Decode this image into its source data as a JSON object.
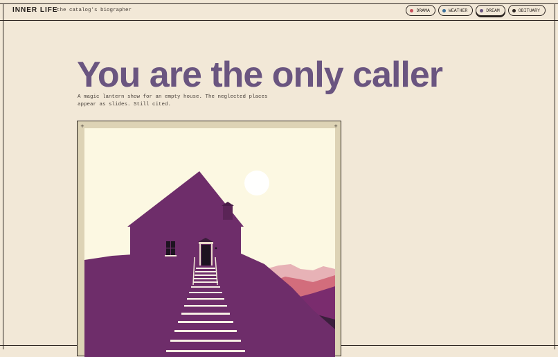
{
  "header": {
    "brand": "INNER LIFE",
    "tagline": "the catalog's biographer",
    "filters": [
      {
        "label": "DRAMA",
        "color": "#c8505a",
        "active": false
      },
      {
        "label": "WEATHER",
        "color": "#3a6f9a",
        "active": false
      },
      {
        "label": "DREAM",
        "color": "#6a5580",
        "active": true
      },
      {
        "label": "OBITUARY",
        "color": "#2b2420",
        "active": false
      }
    ]
  },
  "main": {
    "headline": "You are the only caller",
    "description": "A magic lantern show for an empty house. The neglected places appear as slides. Still cited."
  },
  "colors": {
    "background": "#f2e8d7",
    "headline": "#6a5580",
    "house": "#6e2d6a",
    "sky": "#fcf8e2",
    "mountains": "#d26d7c"
  }
}
